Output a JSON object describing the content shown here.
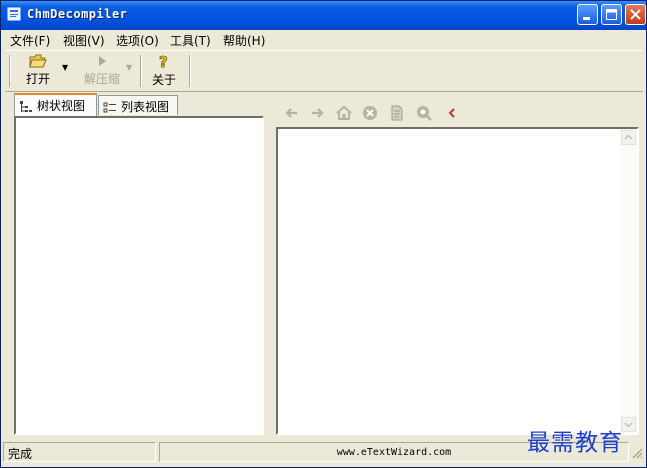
{
  "window": {
    "title": "ChmDecompiler"
  },
  "menu": [
    "文件(F)",
    "视图(V)",
    "选项(O)",
    "工具(T)",
    "帮助(H)"
  ],
  "toolbar": {
    "open_label": "打开",
    "decompress_label": "解压缩",
    "about_label": "关于"
  },
  "left_tabs": [
    "树状视图",
    "列表视图"
  ],
  "nav_icons": [
    "back-arrow",
    "forward-arrow",
    "home",
    "stop",
    "document",
    "search",
    "close-chevron"
  ],
  "status": {
    "text": "完成",
    "url": "www.eTextWizard.com"
  },
  "watermark": "最需教育"
}
